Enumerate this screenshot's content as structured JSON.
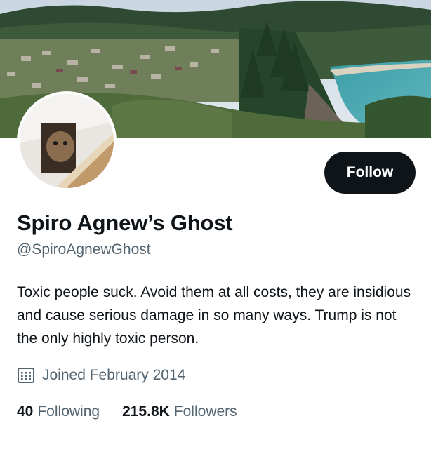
{
  "profile": {
    "display_name": "Spiro Agnew’s Ghost",
    "handle": "@SpiroAgnewGhost",
    "bio": "Toxic people suck. Avoid them at all costs, they are insidious and cause serious damage in so many ways. Trump is not the only highly toxic person.",
    "joined": "Joined February 2014"
  },
  "actions": {
    "follow_label": "Follow"
  },
  "stats": {
    "following_count": "40",
    "following_label": "Following",
    "followers_count": "215.8K",
    "followers_label": "Followers"
  },
  "icons": {
    "joined": "calendar-icon"
  },
  "colors": {
    "text": "#0f1419",
    "secondary": "#536471",
    "button": "#0f1419"
  }
}
